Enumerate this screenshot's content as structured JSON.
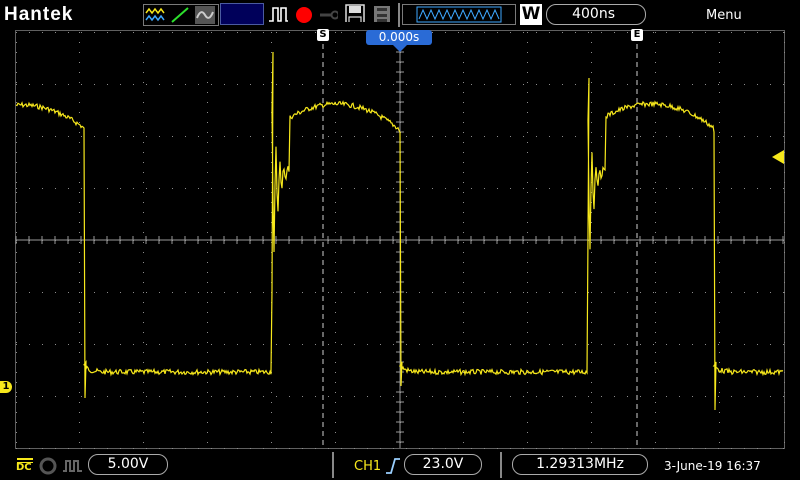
{
  "app": {
    "brand": "Hantek"
  },
  "toolbar": {
    "icons": [
      "waveform-icon",
      "ramp-icon",
      "sine-icon",
      "pulse-icon",
      "record-icon",
      "key-icon",
      "save-icon",
      "disk-icon"
    ],
    "record_color": "#ff0000",
    "timebase_icon": "W",
    "timebase": "400ns",
    "menu_label": "Menu"
  },
  "display": {
    "trigger_time": "0.000s",
    "cursor_start_label": "S",
    "cursor_end_label": "E",
    "channel_marker": "1",
    "trace_color": "#f7e81c"
  },
  "status": {
    "coupling": "DC",
    "volts_per_div": "5.00V",
    "trigger_source": "CH1",
    "trigger_level": "23.0V",
    "frequency": "1.29313MHz",
    "datetime": "3-June-19 16:37"
  }
}
